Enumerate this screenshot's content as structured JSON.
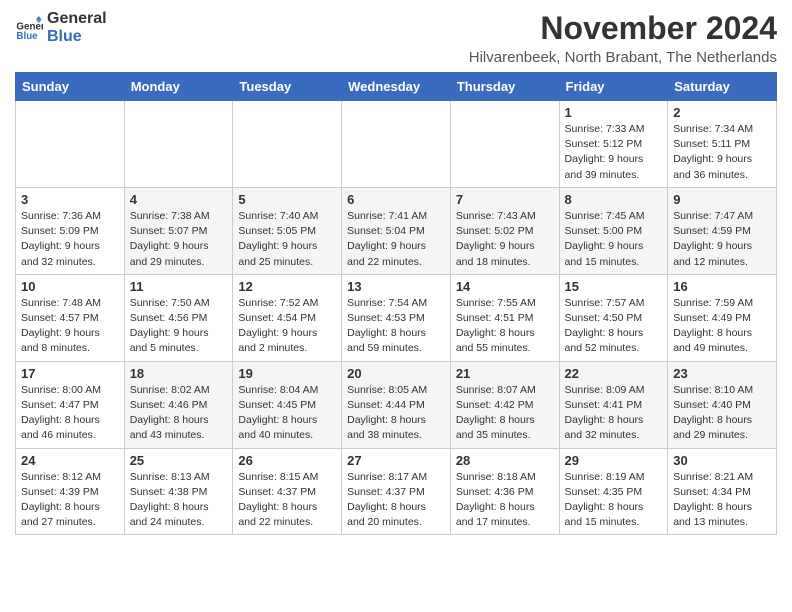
{
  "logo": {
    "line1": "General",
    "line2": "Blue"
  },
  "title": "November 2024",
  "location": "Hilvarenbeek, North Brabant, The Netherlands",
  "weekdays": [
    "Sunday",
    "Monday",
    "Tuesday",
    "Wednesday",
    "Thursday",
    "Friday",
    "Saturday"
  ],
  "weeks": [
    [
      {
        "day": "",
        "info": ""
      },
      {
        "day": "",
        "info": ""
      },
      {
        "day": "",
        "info": ""
      },
      {
        "day": "",
        "info": ""
      },
      {
        "day": "",
        "info": ""
      },
      {
        "day": "1",
        "info": "Sunrise: 7:33 AM\nSunset: 5:12 PM\nDaylight: 9 hours and 39 minutes."
      },
      {
        "day": "2",
        "info": "Sunrise: 7:34 AM\nSunset: 5:11 PM\nDaylight: 9 hours and 36 minutes."
      }
    ],
    [
      {
        "day": "3",
        "info": "Sunrise: 7:36 AM\nSunset: 5:09 PM\nDaylight: 9 hours and 32 minutes."
      },
      {
        "day": "4",
        "info": "Sunrise: 7:38 AM\nSunset: 5:07 PM\nDaylight: 9 hours and 29 minutes."
      },
      {
        "day": "5",
        "info": "Sunrise: 7:40 AM\nSunset: 5:05 PM\nDaylight: 9 hours and 25 minutes."
      },
      {
        "day": "6",
        "info": "Sunrise: 7:41 AM\nSunset: 5:04 PM\nDaylight: 9 hours and 22 minutes."
      },
      {
        "day": "7",
        "info": "Sunrise: 7:43 AM\nSunset: 5:02 PM\nDaylight: 9 hours and 18 minutes."
      },
      {
        "day": "8",
        "info": "Sunrise: 7:45 AM\nSunset: 5:00 PM\nDaylight: 9 hours and 15 minutes."
      },
      {
        "day": "9",
        "info": "Sunrise: 7:47 AM\nSunset: 4:59 PM\nDaylight: 9 hours and 12 minutes."
      }
    ],
    [
      {
        "day": "10",
        "info": "Sunrise: 7:48 AM\nSunset: 4:57 PM\nDaylight: 9 hours and 8 minutes."
      },
      {
        "day": "11",
        "info": "Sunrise: 7:50 AM\nSunset: 4:56 PM\nDaylight: 9 hours and 5 minutes."
      },
      {
        "day": "12",
        "info": "Sunrise: 7:52 AM\nSunset: 4:54 PM\nDaylight: 9 hours and 2 minutes."
      },
      {
        "day": "13",
        "info": "Sunrise: 7:54 AM\nSunset: 4:53 PM\nDaylight: 8 hours and 59 minutes."
      },
      {
        "day": "14",
        "info": "Sunrise: 7:55 AM\nSunset: 4:51 PM\nDaylight: 8 hours and 55 minutes."
      },
      {
        "day": "15",
        "info": "Sunrise: 7:57 AM\nSunset: 4:50 PM\nDaylight: 8 hours and 52 minutes."
      },
      {
        "day": "16",
        "info": "Sunrise: 7:59 AM\nSunset: 4:49 PM\nDaylight: 8 hours and 49 minutes."
      }
    ],
    [
      {
        "day": "17",
        "info": "Sunrise: 8:00 AM\nSunset: 4:47 PM\nDaylight: 8 hours and 46 minutes."
      },
      {
        "day": "18",
        "info": "Sunrise: 8:02 AM\nSunset: 4:46 PM\nDaylight: 8 hours and 43 minutes."
      },
      {
        "day": "19",
        "info": "Sunrise: 8:04 AM\nSunset: 4:45 PM\nDaylight: 8 hours and 40 minutes."
      },
      {
        "day": "20",
        "info": "Sunrise: 8:05 AM\nSunset: 4:44 PM\nDaylight: 8 hours and 38 minutes."
      },
      {
        "day": "21",
        "info": "Sunrise: 8:07 AM\nSunset: 4:42 PM\nDaylight: 8 hours and 35 minutes."
      },
      {
        "day": "22",
        "info": "Sunrise: 8:09 AM\nSunset: 4:41 PM\nDaylight: 8 hours and 32 minutes."
      },
      {
        "day": "23",
        "info": "Sunrise: 8:10 AM\nSunset: 4:40 PM\nDaylight: 8 hours and 29 minutes."
      }
    ],
    [
      {
        "day": "24",
        "info": "Sunrise: 8:12 AM\nSunset: 4:39 PM\nDaylight: 8 hours and 27 minutes."
      },
      {
        "day": "25",
        "info": "Sunrise: 8:13 AM\nSunset: 4:38 PM\nDaylight: 8 hours and 24 minutes."
      },
      {
        "day": "26",
        "info": "Sunrise: 8:15 AM\nSunset: 4:37 PM\nDaylight: 8 hours and 22 minutes."
      },
      {
        "day": "27",
        "info": "Sunrise: 8:17 AM\nSunset: 4:37 PM\nDaylight: 8 hours and 20 minutes."
      },
      {
        "day": "28",
        "info": "Sunrise: 8:18 AM\nSunset: 4:36 PM\nDaylight: 8 hours and 17 minutes."
      },
      {
        "day": "29",
        "info": "Sunrise: 8:19 AM\nSunset: 4:35 PM\nDaylight: 8 hours and 15 minutes."
      },
      {
        "day": "30",
        "info": "Sunrise: 8:21 AM\nSunset: 4:34 PM\nDaylight: 8 hours and 13 minutes."
      }
    ]
  ]
}
